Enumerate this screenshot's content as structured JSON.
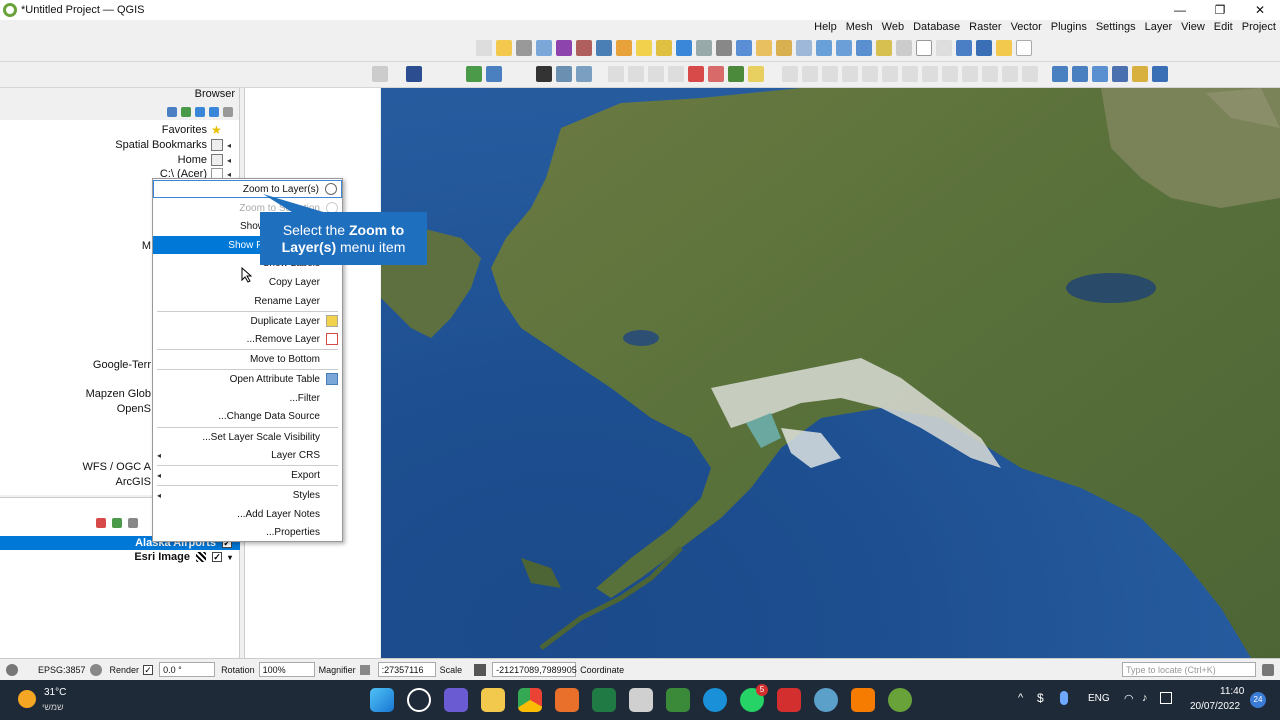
{
  "window": {
    "title": "*Untitled Project — QGIS",
    "minimize": "—",
    "maximize": "❐",
    "close": "✕"
  },
  "menubar": [
    "Project",
    "Edit",
    "View",
    "Layer",
    "Settings",
    "Plugins",
    "Vector",
    "Raster",
    "Database",
    "Web",
    "Mesh",
    "Help"
  ],
  "browser": {
    "title": "Browser",
    "items": [
      {
        "label": "Favorites",
        "icon": "star-icon"
      },
      {
        "label": "Spatial Bookmarks",
        "icon": "bookmark-icon"
      },
      {
        "label": "Home",
        "icon": "home-icon"
      },
      {
        "label": "C:\\ (Acer)",
        "icon": "drive-icon"
      },
      {
        "label": "M",
        "icon": ""
      },
      {
        "label": "Google-Terr",
        "icon": ""
      },
      {
        "label": "Mapzen Glob",
        "icon": ""
      },
      {
        "label": "OpenS",
        "icon": ""
      },
      {
        "label": "WFS / OGC A",
        "icon": ""
      },
      {
        "label": "ArcGIS",
        "icon": ""
      }
    ]
  },
  "layers": [
    {
      "name": "Alaska Airports",
      "checked": "✓",
      "selected": true
    },
    {
      "name": "Esri Image",
      "checked": "✓",
      "selected": false
    }
  ],
  "context_menu": {
    "items": [
      {
        "label": "Zoom to Layer(s)",
        "state": "normal"
      },
      {
        "label": "Zoom to Selection",
        "state": "disabled"
      },
      {
        "label": "Show in Overview",
        "state": "normal"
      },
      {
        "label": "Show Feature Count",
        "state": "highlighted"
      },
      {
        "label": "Show Labels",
        "state": "normal"
      },
      {
        "label": "Copy Layer",
        "state": "normal"
      },
      {
        "label": "Rename Layer",
        "state": "normal"
      },
      {
        "label": "Duplicate Layer",
        "state": "normal"
      },
      {
        "label": "...Remove Layer",
        "state": "normal"
      },
      {
        "label": "Move to Bottom",
        "state": "normal"
      },
      {
        "label": "Open Attribute Table",
        "state": "normal"
      },
      {
        "label": "...Filter",
        "state": "normal"
      },
      {
        "label": "...Change Data Source",
        "state": "normal"
      },
      {
        "label": "...Set Layer Scale Visibility",
        "state": "normal"
      },
      {
        "label": "Layer CRS",
        "state": "normal"
      },
      {
        "label": "Export",
        "state": "normal"
      },
      {
        "label": "Styles",
        "state": "normal"
      },
      {
        "label": "...Add Layer Notes",
        "state": "normal"
      },
      {
        "label": "...Properties",
        "state": "normal"
      }
    ]
  },
  "callout": {
    "prefix": "Select the ",
    "bold": "Zoom to Layer(s)",
    "suffix": " menu item"
  },
  "statusbar": {
    "coordinate_value": "-21217089,7989905",
    "coordinate_label": "Coordinate",
    "scale_label": "Scale",
    "scale_value": ":27357116",
    "magnifier_label": "Magnifier",
    "magnifier_value": "100%",
    "rotation_label": "Rotation",
    "rotation_value": "0.0 °",
    "render_label": "Render",
    "crs": "EPSG:3857",
    "locate_placeholder": "Type to locate (Ctrl+K)"
  },
  "taskbar": {
    "temp": "31°C",
    "weather_sub": "שמשי",
    "lang": "ENG",
    "time": "11:40",
    "date": "20/07/2022",
    "notif_count": "24",
    "whatsapp_badge": "5"
  },
  "colors": {
    "accent": "#0078d7",
    "callout": "#1f6fbf",
    "taskbar": "#1e2a38"
  }
}
